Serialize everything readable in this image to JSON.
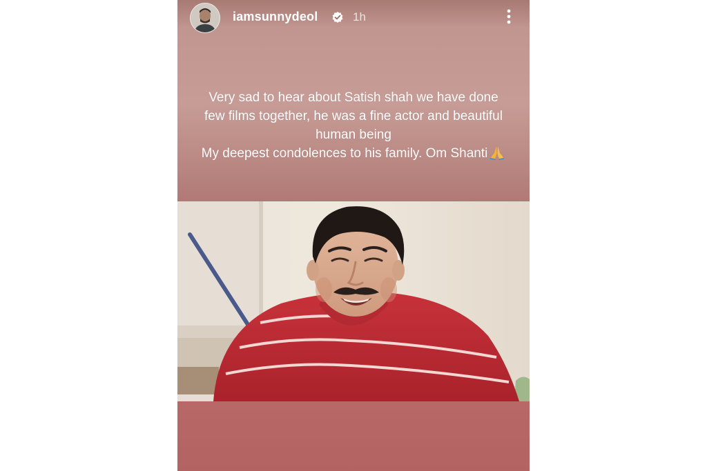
{
  "story": {
    "username": "iamsunnydeol",
    "time_ago": "1h",
    "verified": true,
    "icons": {
      "verified": "verified-badge-icon",
      "more": "more-vertical-icon",
      "emoji": "folded-hands-emoji"
    },
    "caption_lines": [
      "Very sad to hear about Satish shah we have done",
      "few films together, he was a fine actor and beautiful",
      "human being",
      "My deepest condolences to his family. Om Shanti"
    ],
    "colors": {
      "gradient_top": "#c19590",
      "gradient_mid": "#b98782",
      "bottom_band": "#b36462",
      "shirt": "#c8323a"
    }
  }
}
